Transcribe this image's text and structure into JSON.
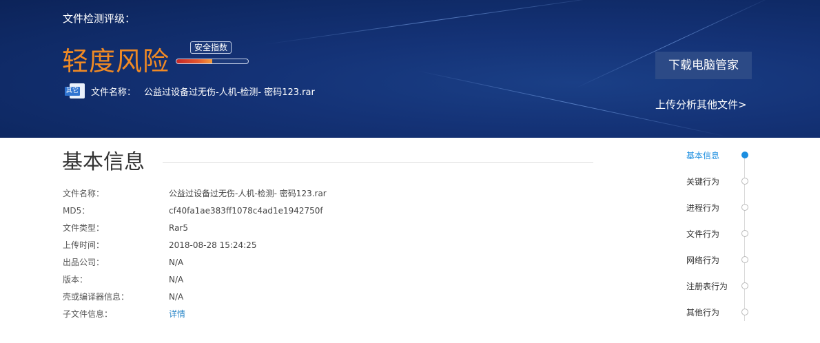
{
  "header": {
    "rating_label": "文件检测评级：",
    "risk_level": "轻度风险",
    "safety_index_label": "安全指数",
    "safety_index_fraction": 0.5,
    "file_badge": "其它",
    "file_name_label": "文件名称：",
    "file_name": "公益过设备过无伤-人机-检测- 密码123.rar",
    "download_button": "下载电脑管家",
    "upload_link": "上传分析其他文件>"
  },
  "basic_info": {
    "title": "基本信息",
    "rows": [
      {
        "key": "文件名称：",
        "value": "公益过设备过无伤-人机-检测- 密码123.rar"
      },
      {
        "key": "MD5：",
        "value": "cf40fa1ae383ff1078c4ad1e1942750f"
      },
      {
        "key": "文件类型：",
        "value": "Rar5"
      },
      {
        "key": "上传时间：",
        "value": "2018-08-28 15:24:25"
      },
      {
        "key": "出品公司：",
        "value": "N/A"
      },
      {
        "key": "版本：",
        "value": "N/A"
      },
      {
        "key": "壳或编译器信息：",
        "value": "N/A"
      },
      {
        "key": "子文件信息：",
        "value": "详情"
      }
    ]
  },
  "sidenav": {
    "items": [
      {
        "label": "基本信息",
        "active": true
      },
      {
        "label": "关键行为",
        "active": false
      },
      {
        "label": "进程行为",
        "active": false
      },
      {
        "label": "文件行为",
        "active": false
      },
      {
        "label": "网络行为",
        "active": false
      },
      {
        "label": "注册表行为",
        "active": false
      },
      {
        "label": "其他行为",
        "active": false
      }
    ]
  },
  "colors": {
    "risk_orange": "#f08a24",
    "link_blue": "#2b87c8",
    "active_blue": "#1b8ee0",
    "banner_navy": "#143276"
  }
}
